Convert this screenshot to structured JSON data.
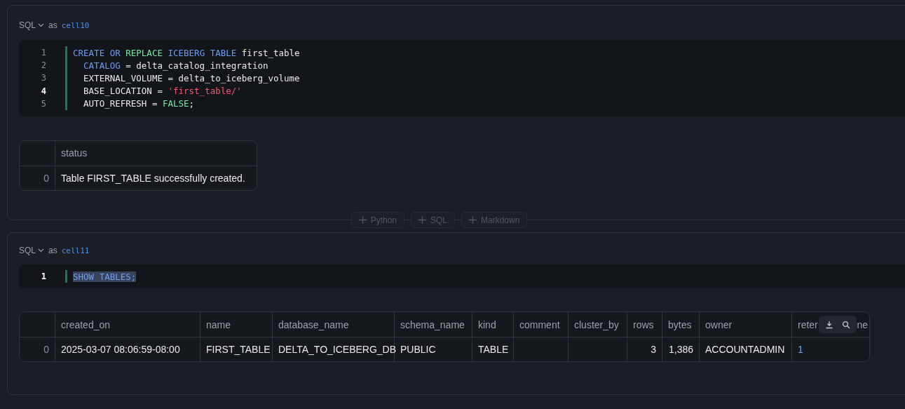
{
  "cells": [
    {
      "language": "SQL",
      "as_label": "as",
      "name": "cell10",
      "code": [
        {
          "number": "1",
          "active": false,
          "tokens": [
            {
              "text": "CREATE OR",
              "kind": "keyword"
            },
            {
              "text": " REPLACE",
              "kind": "builtin"
            },
            {
              "text": " ICEBERG TABLE",
              "kind": "keyword"
            },
            {
              "text": " first_table",
              "kind": "plain"
            }
          ]
        },
        {
          "number": "2",
          "active": false,
          "tokens": [
            {
              "text": "  CATALOG",
              "kind": "keyword"
            },
            {
              "text": " = delta_catalog_integration",
              "kind": "plain"
            }
          ]
        },
        {
          "number": "3",
          "active": false,
          "tokens": [
            {
              "text": "  EXTERNAL_VOLUME = delta_to_iceberg_volume",
              "kind": "plain"
            }
          ]
        },
        {
          "number": "4",
          "active": true,
          "tokens": [
            {
              "text": "  BASE_LOCATION = ",
              "kind": "plain"
            },
            {
              "text": "'first_table/'",
              "kind": "string"
            }
          ]
        },
        {
          "number": "5",
          "active": false,
          "tokens": [
            {
              "text": "  AUTO_REFRESH = ",
              "kind": "plain"
            },
            {
              "text": "FALSE",
              "kind": "builtin"
            },
            {
              "text": ";",
              "kind": "plain"
            }
          ]
        }
      ],
      "result": {
        "columns": [
          {
            "label": "status"
          }
        ],
        "rows": [
          {
            "index": "0",
            "values": [
              {
                "text": "Table FIRST_TABLE successfully created."
              }
            ]
          }
        ]
      }
    },
    {
      "language": "SQL",
      "as_label": "as",
      "name": "cell11",
      "code": [
        {
          "number": "1",
          "active": true,
          "tokens": [
            {
              "text": "SHOW TABLES;",
              "kind": "selected"
            }
          ]
        }
      ],
      "result": {
        "columns": [
          {
            "label": "created_on"
          },
          {
            "label": "name"
          },
          {
            "label": "database_name"
          },
          {
            "label": "schema_name"
          },
          {
            "label": "kind"
          },
          {
            "label": "comment"
          },
          {
            "label": "cluster_by"
          },
          {
            "label": "rows"
          },
          {
            "label": "bytes"
          },
          {
            "label": "owner"
          },
          {
            "label": "reter",
            "label_end": "ne"
          }
        ],
        "rows": [
          {
            "index": "0",
            "values": [
              {
                "text": "2025-03-07 08:06:59-08:00"
              },
              {
                "text": "FIRST_TABLE"
              },
              {
                "text": "DELTA_TO_ICEBERG_DB"
              },
              {
                "text": "PUBLIC"
              },
              {
                "text": "TABLE"
              },
              {
                "blank": true
              },
              {
                "blank": true
              },
              {
                "text": "3"
              },
              {
                "text": "1,386"
              },
              {
                "text": "ACCOUNTADMIN"
              },
              {
                "text": "1"
              }
            ]
          }
        ]
      }
    }
  ],
  "add_cell_buttons": [
    {
      "label": "Python"
    },
    {
      "label": "SQL"
    },
    {
      "label": "Markdown"
    }
  ]
}
